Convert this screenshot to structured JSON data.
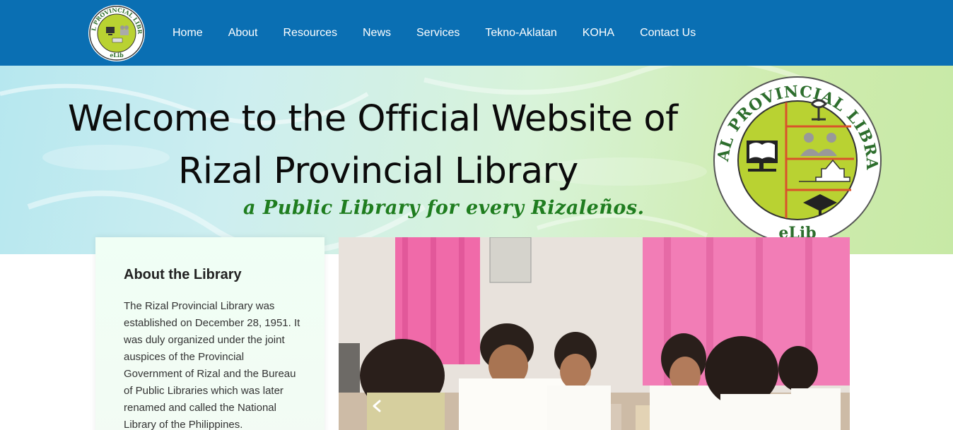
{
  "brand": {
    "logo_icon": "rizal-provincial-library-seal",
    "seal_text": "RIZAL PROVINCIAL LIBRARY",
    "seal_sub": "eLib"
  },
  "nav": {
    "items": [
      {
        "label": "Home"
      },
      {
        "label": "About"
      },
      {
        "label": "Resources"
      },
      {
        "label": "News"
      },
      {
        "label": "Services"
      },
      {
        "label": "Tekno-Aklatan"
      },
      {
        "label": "KOHA"
      },
      {
        "label": "Contact Us"
      }
    ]
  },
  "hero": {
    "title_line1": "Welcome to the Official Website of",
    "title_line2": "Rizal Provincial Library",
    "tagline": "a Public Library for every Rizaleños."
  },
  "about": {
    "title": "About the Library",
    "text": "The Rizal Provincial Library was established on December 28, 1951. It was duly organized under the joint auspices of the Provincial Government of Rizal and the Bureau of Public Libraries which was later renamed and called the National Library of the Philippines."
  },
  "carousel": {
    "prev_icon": "chevron-left-icon",
    "image_icon": "students-studying-photo"
  },
  "colors": {
    "nav_bg": "#0a6fb3",
    "tagline": "#1f7d1f",
    "seal_green": "#b9d232"
  }
}
